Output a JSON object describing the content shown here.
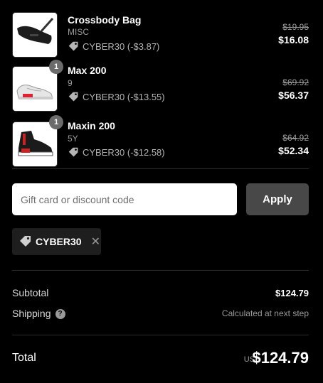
{
  "items": [
    {
      "name": "Crossbody Bag",
      "variant": "MISC",
      "discount": "CYBER30 (-$3.87)",
      "original_price": "$19.95",
      "final_price": "$16.08",
      "quantity": "",
      "image_icon": "bag-image"
    },
    {
      "name": "Max 200",
      "variant": "9",
      "discount": "CYBER30 (-$13.55)",
      "original_price": "$69.92",
      "final_price": "$56.37",
      "quantity": "1",
      "image_icon": "sneaker-white-image"
    },
    {
      "name": "Maxin 200",
      "variant": "5Y",
      "discount": "CYBER30 (-$12.58)",
      "original_price": "$64.92",
      "final_price": "$52.34",
      "quantity": "1",
      "image_icon": "sneaker-black-image"
    }
  ],
  "discount_form": {
    "placeholder": "Gift card or discount code",
    "value": "",
    "apply_label": "Apply"
  },
  "applied_code": {
    "label": "CYBER30",
    "remove_icon": "close-icon"
  },
  "summary": {
    "subtotal_label": "Subtotal",
    "subtotal_value": "$124.79",
    "shipping_label": "Shipping",
    "shipping_help": "?",
    "shipping_value": "Calculated at next step",
    "total_label": "Total",
    "currency": "USD",
    "total_value": "$124.79"
  },
  "colors": {
    "background": "#000000",
    "apply_button": "#484848",
    "chip_background": "#1e1e1e",
    "muted_text": "#9a9a9a"
  }
}
